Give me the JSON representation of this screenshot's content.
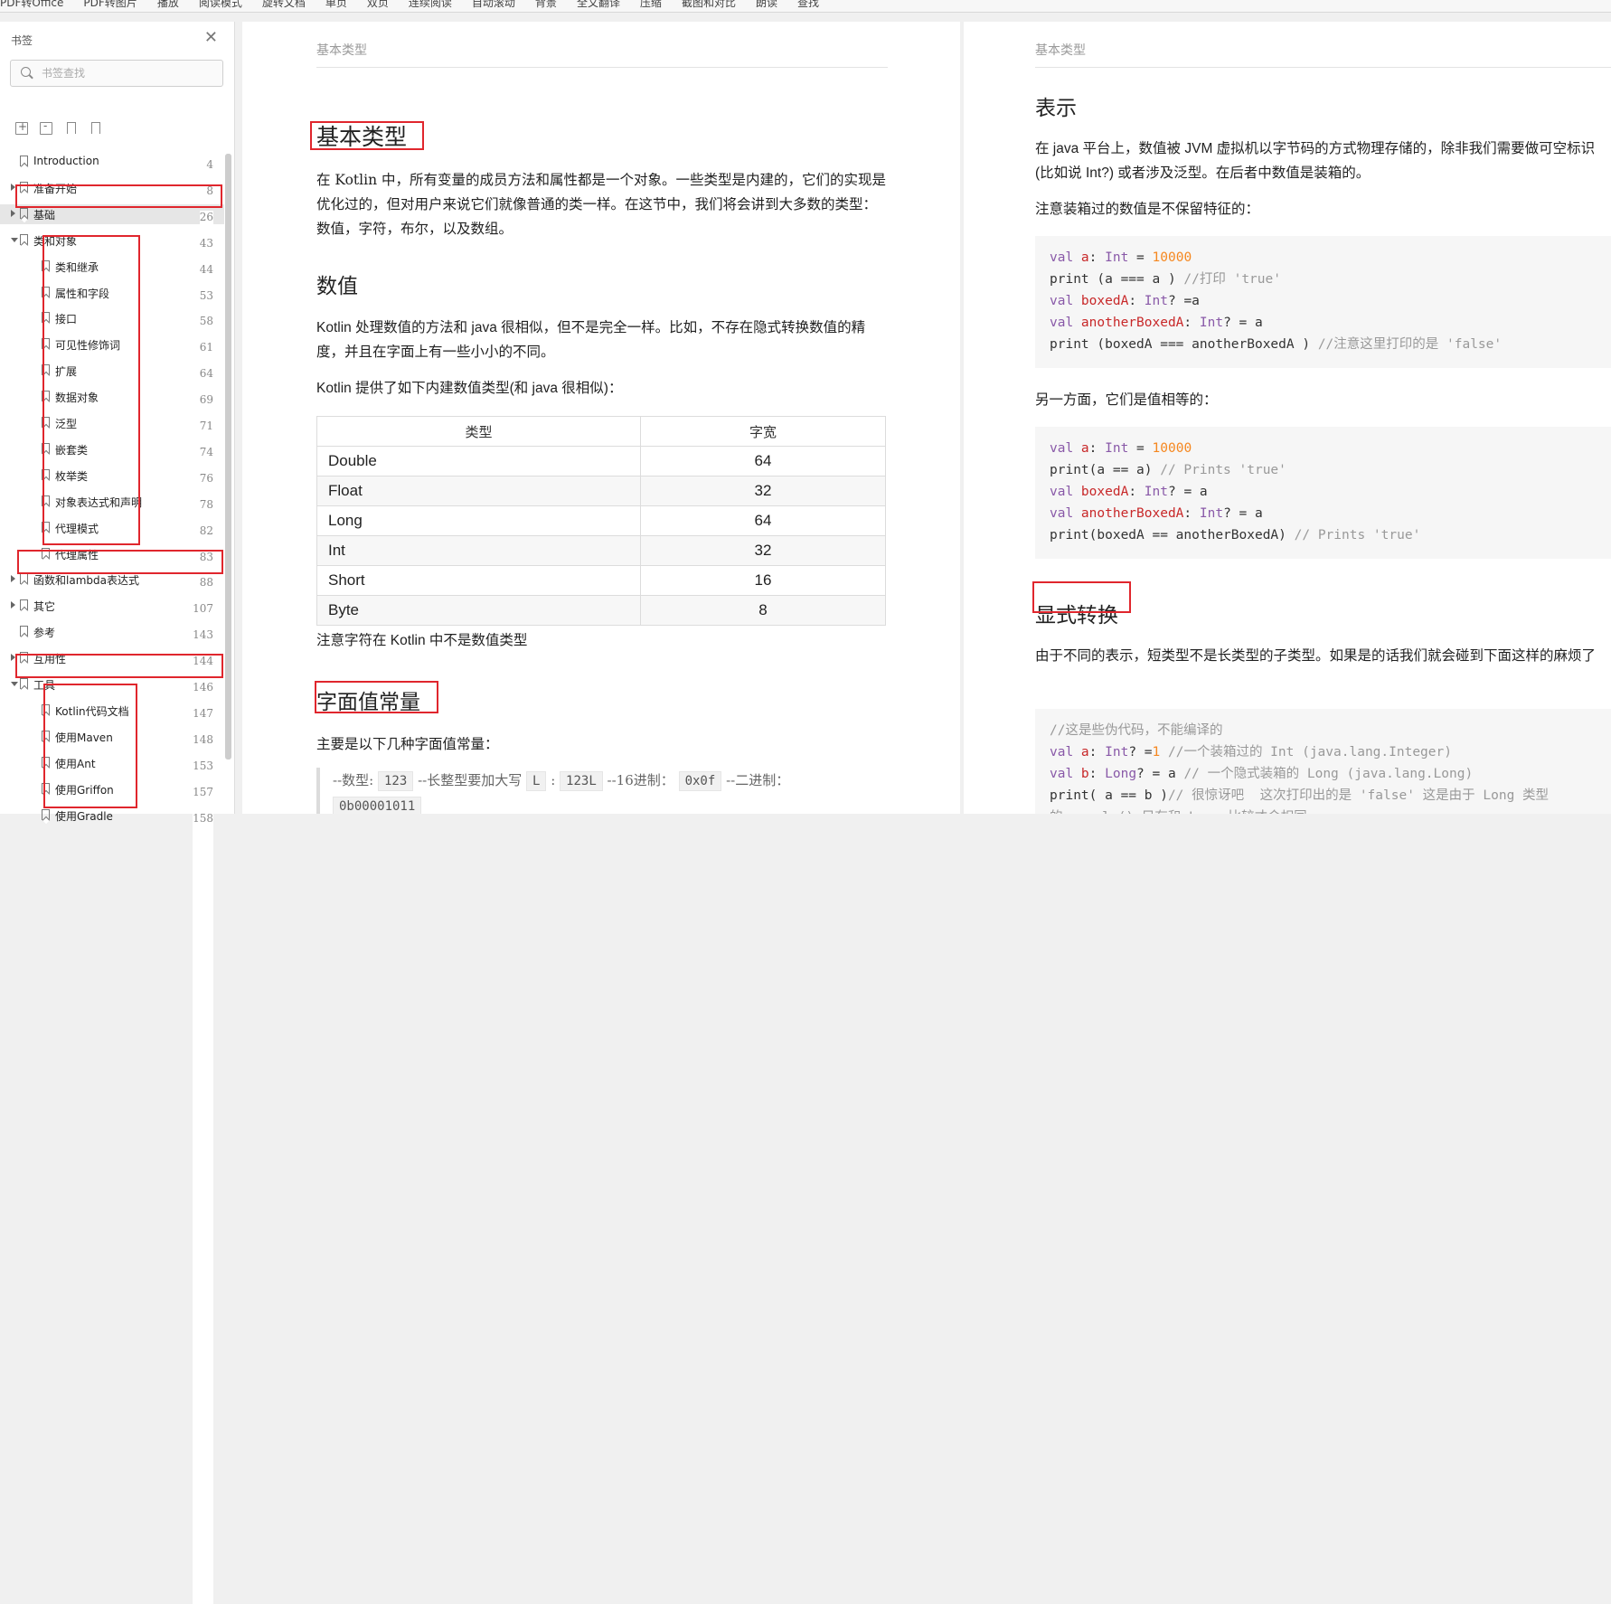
{
  "toolbar": {
    "items": [
      "PDF转Office",
      "PDF转图片",
      "播放",
      "阅读模式",
      "旋转文档",
      "单页",
      "双页",
      "连续阅读",
      "自动滚动",
      "背景",
      "全文翻译",
      "压缩",
      "截图和对比",
      "朗读",
      "查找"
    ]
  },
  "sidebar": {
    "title": "书签",
    "search_placeholder": "书签查找",
    "items": [
      {
        "label": "Introduction",
        "page": "4",
        "level": 0,
        "arrow": "none"
      },
      {
        "label": "准备开始",
        "page": "8",
        "level": 0,
        "arrow": "right"
      },
      {
        "label": "基础",
        "page": "26",
        "level": 0,
        "arrow": "right",
        "selected": true
      },
      {
        "label": "类和对象",
        "page": "43",
        "level": 0,
        "arrow": "down"
      },
      {
        "label": "类和继承",
        "page": "44",
        "level": 1,
        "arrow": "none"
      },
      {
        "label": "属性和字段",
        "page": "53",
        "level": 1,
        "arrow": "none"
      },
      {
        "label": "接口",
        "page": "58",
        "level": 1,
        "arrow": "none"
      },
      {
        "label": "可见性修饰词",
        "page": "61",
        "level": 1,
        "arrow": "none"
      },
      {
        "label": "扩展",
        "page": "64",
        "level": 1,
        "arrow": "none"
      },
      {
        "label": "数据对象",
        "page": "69",
        "level": 1,
        "arrow": "none"
      },
      {
        "label": "泛型",
        "page": "71",
        "level": 1,
        "arrow": "none"
      },
      {
        "label": "嵌套类",
        "page": "74",
        "level": 1,
        "arrow": "none"
      },
      {
        "label": "枚举类",
        "page": "76",
        "level": 1,
        "arrow": "none"
      },
      {
        "label": "对象表达式和声明",
        "page": "78",
        "level": 1,
        "arrow": "none"
      },
      {
        "label": "代理模式",
        "page": "82",
        "level": 1,
        "arrow": "none"
      },
      {
        "label": "代理属性",
        "page": "83",
        "level": 1,
        "arrow": "none"
      },
      {
        "label": "函数和lambda表达式",
        "page": "88",
        "level": 0,
        "arrow": "right"
      },
      {
        "label": "其它",
        "page": "107",
        "level": 0,
        "arrow": "right"
      },
      {
        "label": "参考",
        "page": "143",
        "level": 0,
        "arrow": "none"
      },
      {
        "label": "互用性",
        "page": "144",
        "level": 0,
        "arrow": "right"
      },
      {
        "label": "工具",
        "page": "146",
        "level": 0,
        "arrow": "down"
      },
      {
        "label": "Kotlin代码文档",
        "page": "147",
        "level": 1,
        "arrow": "none"
      },
      {
        "label": "使用Maven",
        "page": "148",
        "level": 1,
        "arrow": "none"
      },
      {
        "label": "使用Ant",
        "page": "153",
        "level": 1,
        "arrow": "none"
      },
      {
        "label": "使用Griffon",
        "page": "157",
        "level": 1,
        "arrow": "none"
      },
      {
        "label": "使用Gradle",
        "page": "158",
        "level": 1,
        "arrow": "none"
      }
    ]
  },
  "page1": {
    "runhead": "基本类型",
    "h1": "基本类型",
    "intro": "在 Kotlin 中，所有变量的成员方法和属性都是一个对象。一些类型是内建的，它们的实现是优化过的，但对用户来说它们就像普通的类一样。在这节中，我们将会讲到大多数的类型：数值，字符，布尔，以及数组。",
    "h2_numbers": "数值",
    "numbers_p1": "Kotlin 处理数值的方法和 java 很相似，但不是完全一样。比如，不存在隐式转换数值的精度，并且在字面上有一些小小的不同。",
    "numbers_p2": "Kotlin 提供了如下内建数值类型(和 java 很相似)：",
    "table": {
      "headers": [
        "类型",
        "字宽"
      ],
      "rows": [
        [
          "Double",
          "64"
        ],
        [
          "Float",
          "32"
        ],
        [
          "Long",
          "64"
        ],
        [
          "Int",
          "32"
        ],
        [
          "Short",
          "16"
        ],
        [
          "Byte",
          "8"
        ]
      ]
    },
    "note": "注意字符在 Kotlin 中不是数值类型",
    "h2_literals": "字面值常量",
    "literals_p": "主要是以下几种字面值常量：",
    "quote": {
      "t1": "--数型:",
      "c1": "123",
      "t2": "--长整型要加大写",
      "c2": "L",
      "t3": ":",
      "c3": "123L",
      "t4": "--16进制：",
      "c4": "0x0f",
      "t5": "--二进制：",
      "c5": "0b00001011"
    }
  },
  "page2": {
    "runhead": "基本类型",
    "h2_repr": "表示",
    "repr_p1": "在 java 平台上，数值被 JVM 虚拟机以字节码的方式物理存储的，除非我们需要做可空标识(比如说 Int?) 或者涉及泛型。在后者中数值是装箱的。",
    "repr_p2": "注意装箱过的数值是不保留特征的：",
    "code1": [
      [
        "val ",
        "a",
        ": ",
        "Int",
        " = ",
        "10000",
        ""
      ],
      [
        "print (a === a ) ",
        "",
        "",
        "",
        "",
        "",
        "//打印 'true'"
      ],
      [
        "val ",
        "boxedA",
        ": ",
        "Int",
        "? =a",
        "",
        ""
      ],
      [
        "val ",
        "anotherBoxedA",
        ": ",
        "Int",
        "? = a",
        "",
        ""
      ],
      [
        "print (boxedA === anotherBoxedA ) ",
        "",
        "",
        "",
        "",
        "",
        "//注意这里打印的是 'false'"
      ]
    ],
    "repr_p3": "另一方面，它们是值相等的：",
    "code2": [
      [
        "val ",
        "a",
        ": ",
        "Int",
        " = ",
        "10000",
        ""
      ],
      [
        "print(a == a) ",
        "",
        "",
        "",
        "",
        "",
        "// Prints 'true'"
      ],
      [
        "val ",
        "boxedA",
        ": ",
        "Int",
        "? = a",
        "",
        ""
      ],
      [
        "val ",
        "anotherBoxedA",
        ": ",
        "Int",
        "? = a",
        "",
        ""
      ],
      [
        "print(boxedA == anotherBoxedA) ",
        "",
        "",
        "",
        "",
        "",
        "// Prints 'true'"
      ]
    ],
    "h2_conv": "显式转换",
    "conv_p": "由于不同的表示，短类型不是长类型的子类型。如果是的话我们就会碰到下面这样的麻烦了",
    "code3": [
      [
        "",
        "",
        "",
        "",
        "",
        "",
        "//这是些伪代码，不能编译的"
      ],
      [
        "val ",
        "a",
        ": ",
        "Int",
        "? =",
        "1",
        " //一个装箱过的 Int (java.lang.Integer)"
      ],
      [
        "val ",
        "b",
        ": ",
        "Long",
        "? = a ",
        "",
        "// 一个隐式装箱的 Long (java.lang.Long)"
      ],
      [
        "print( a == b )",
        "",
        "",
        "",
        "",
        "",
        "// 很惊讶吧  这次打印出的是 'false' 这是由于 Long 类型"
      ],
      [
        "",
        "",
        "",
        "",
        "",
        "",
        "的 equals() 只有和 Long 比较才会相同"
      ]
    ]
  }
}
